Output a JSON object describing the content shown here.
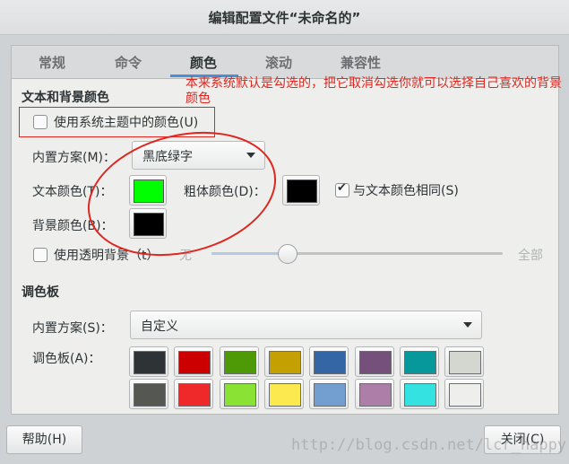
{
  "window": {
    "title": "编辑配置文件“未命名的”"
  },
  "tabs": [
    {
      "label": "常规",
      "active": false
    },
    {
      "label": "命令",
      "active": false
    },
    {
      "label": "颜色",
      "active": true
    },
    {
      "label": "滚动",
      "active": false
    },
    {
      "label": "兼容性",
      "active": false
    }
  ],
  "annotation": {
    "text": "本来系统默认是勾选的，把它取消勾选你就可以选择自己喜欢的背景颜色",
    "color": "#e0261e"
  },
  "text_bg": {
    "section_title": "文本和背景颜色",
    "use_system_theme_label": "使用系统主题中的颜色(U)",
    "use_system_theme_checked": false,
    "builtin_scheme_label": "内置方案(M)：",
    "builtin_scheme_value": "黑底绿字",
    "text_color_label": "文本颜色(T)：",
    "text_color": "#00ff00",
    "bold_color_label": "粗体颜色(D)：",
    "bold_color": "#000000",
    "same_as_text_label": "与文本颜色相同(S)",
    "same_as_text_checked": true,
    "bg_color_label": "背景颜色(B)：",
    "bg_color": "#000000",
    "transparent_label": "使用透明背景（t）",
    "transparent_checked": false,
    "slider_min_label": "无",
    "slider_max_label": "全部",
    "slider_value": 0.26
  },
  "palette": {
    "section_title": "调色板",
    "builtin_scheme_label": "内置方案(S)：",
    "builtin_scheme_value": "自定义",
    "palette_label": "调色板(A)：",
    "colors": [
      "#2e3436",
      "#cc0000",
      "#4e9a06",
      "#c4a000",
      "#3465a4",
      "#75507b",
      "#06989a",
      "#d3d7cf",
      "#555753",
      "#ef2929",
      "#8ae234",
      "#fce94f",
      "#729fcf",
      "#ad7fa8",
      "#34e2e2",
      "#eeeeec"
    ]
  },
  "buttons": {
    "help": "帮助(H)",
    "close": "关闭(C)"
  },
  "watermark": "http://blog.csdn.net/lcr_happy"
}
